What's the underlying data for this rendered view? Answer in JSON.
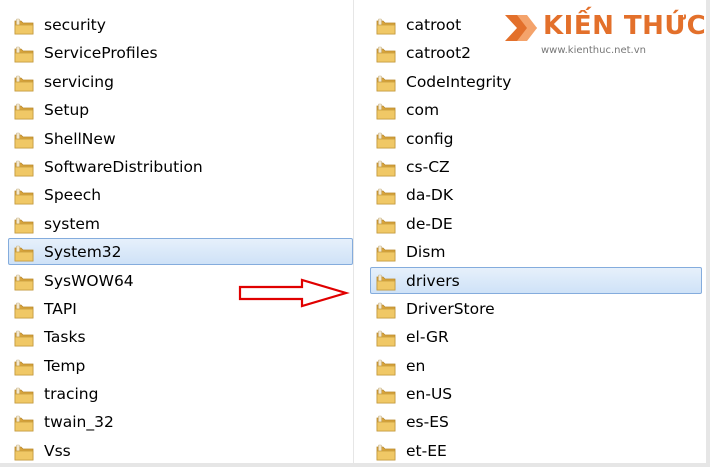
{
  "left_list": {
    "items": [
      {
        "label": "security"
      },
      {
        "label": "ServiceProfiles"
      },
      {
        "label": "servicing"
      },
      {
        "label": "Setup"
      },
      {
        "label": "ShellNew"
      },
      {
        "label": "SoftwareDistribution"
      },
      {
        "label": "Speech"
      },
      {
        "label": "system"
      },
      {
        "label": "System32",
        "selected": true
      },
      {
        "label": "SysWOW64"
      },
      {
        "label": "TAPI"
      },
      {
        "label": "Tasks"
      },
      {
        "label": "Temp"
      },
      {
        "label": "tracing"
      },
      {
        "label": "twain_32"
      },
      {
        "label": "Vss"
      }
    ]
  },
  "right_list": {
    "items": [
      {
        "label": "catroot"
      },
      {
        "label": "catroot2"
      },
      {
        "label": "CodeIntegrity"
      },
      {
        "label": "com"
      },
      {
        "label": "config"
      },
      {
        "label": "cs-CZ"
      },
      {
        "label": "da-DK"
      },
      {
        "label": "de-DE"
      },
      {
        "label": "Dism"
      },
      {
        "label": "drivers",
        "selected": true
      },
      {
        "label": "DriverStore"
      },
      {
        "label": "el-GR"
      },
      {
        "label": "en"
      },
      {
        "label": "en-US"
      },
      {
        "label": "es-ES"
      },
      {
        "label": "et-EE"
      }
    ]
  },
  "watermark": {
    "brand": "KIẾN THỨC",
    "url": "www.kienthuc.net.vn"
  },
  "colors": {
    "selection_fill": "#d6e6f9",
    "selection_border": "#84acdd",
    "arrow": "#e00000",
    "folder": "#e7b94a",
    "logo": "#e3702b"
  },
  "icons": {
    "folder": "folder-icon",
    "arrow": "right-arrow-icon",
    "logo": "kienthuc-logo-icon"
  }
}
